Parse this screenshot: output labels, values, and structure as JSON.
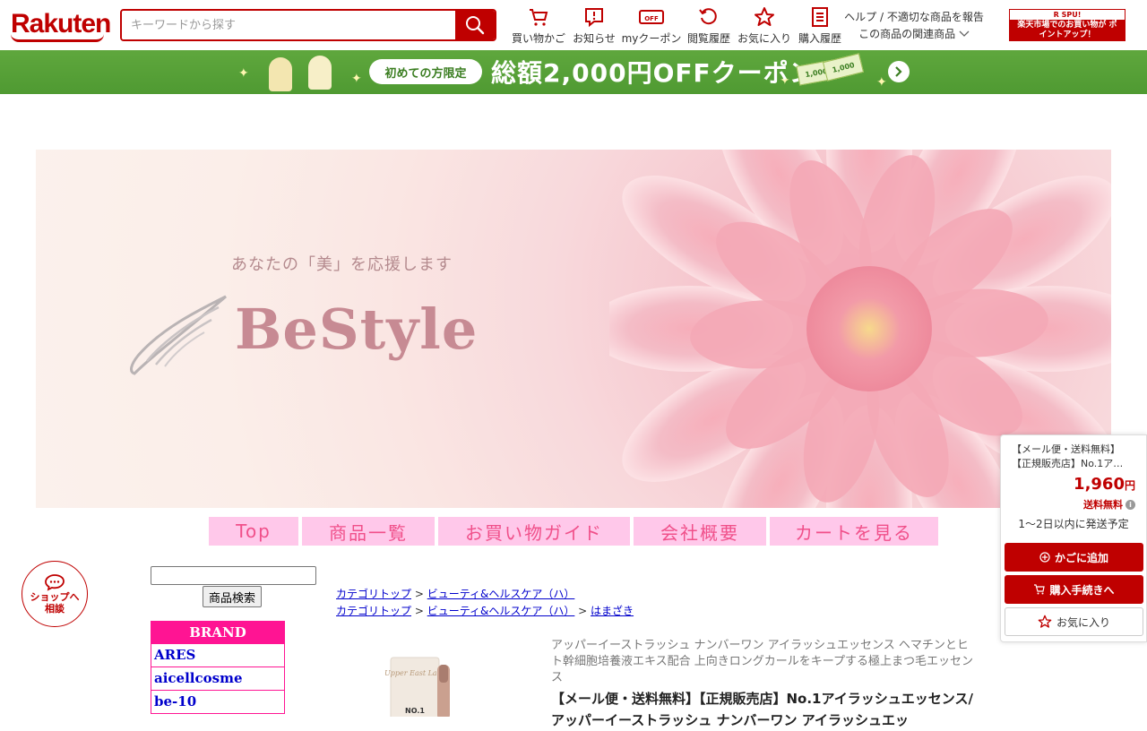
{
  "header": {
    "logo": "Rakuten",
    "search_placeholder": "キーワードから探す",
    "nav": [
      {
        "label": "買い物かご",
        "icon": "cart-icon"
      },
      {
        "label": "お知らせ",
        "icon": "notice-icon"
      },
      {
        "label": "myクーポン",
        "icon": "coupon-icon"
      },
      {
        "label": "閲覧履歴",
        "icon": "history-icon"
      },
      {
        "label": "お気に入り",
        "icon": "star-icon"
      },
      {
        "label": "購入履歴",
        "icon": "receipt-icon"
      }
    ],
    "coupon_icon_text": "OFF",
    "help_link": "ヘルプ / 不適切な商品を報告",
    "related_link": "この商品の関連商品",
    "spu_top": "R SPU!",
    "spu_text": "楽天市場でのお買い物が ポイントアップ！"
  },
  "coupon_banner": {
    "pill": "初めての方限定",
    "headline": "総額2,000円OFFクーポン",
    "ticket_value": "1,000"
  },
  "shop_banner": {
    "tagline": "あなたの「美」を応援します",
    "brand": "BeStyle"
  },
  "shop_nav": [
    {
      "label": "Top"
    },
    {
      "label": "商品一覧"
    },
    {
      "label": "お買い物ガイド"
    },
    {
      "label": "会社概要"
    },
    {
      "label": "カートを見る"
    }
  ],
  "left": {
    "search_button": "商品検索",
    "brand_header": "BRAND",
    "brands": [
      "ARES",
      "aicellcosme",
      "be-10"
    ]
  },
  "breadcrumbs": [
    [
      "カテゴリトップ",
      "ビューティ&ヘルスケア（ハ）"
    ],
    [
      "カテゴリトップ",
      "ビューティ&ヘルスケア（ハ）",
      "はまざき"
    ]
  ],
  "product": {
    "subtitle": "アッパーイーストラッシュ ナンバーワン アイラッシュエッセンス ヘマチンとヒト幹細胞培養液エキス配合 上向きロングカールをキープする極上まつ毛エッセンス",
    "title": "【メール便・送料無料】【正規販売店】No.1アイラッシュエッセンス/アッパーイーストラッシュ ナンバーワン アイラッシュエッ",
    "image_label_1": "Upper East Lash",
    "image_label_2": "NO.1"
  },
  "cart_panel": {
    "title_line1": "【メール便・送料無料】",
    "title_line2": "【正規販売店】No.1ア…",
    "price": "1,960",
    "price_unit": "円",
    "shipping": "送料無料",
    "info_mark": "i",
    "delivery": "1～2日以内に発送予定",
    "add_to_cart": "かごに追加",
    "checkout": "購入手続きへ",
    "favorite": "お気に入り"
  },
  "consult": {
    "line1": "ショップへ",
    "line2": "相談"
  }
}
